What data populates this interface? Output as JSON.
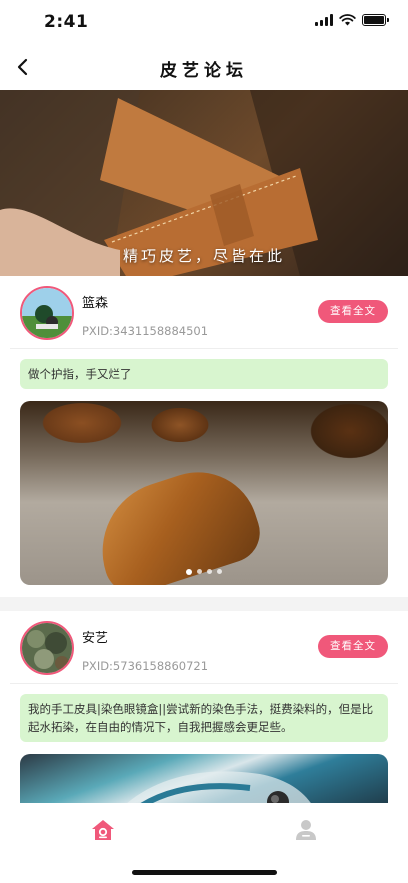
{
  "status_bar": {
    "time": "2:41"
  },
  "header": {
    "title": "皮艺论坛",
    "back_icon": "chevron-left-icon"
  },
  "banner": {
    "caption": "精巧皮艺，尽皆在此"
  },
  "posts": [
    {
      "author": "篮森",
      "pxid": "PXID:3431158884501",
      "read_more_label": "查看全文",
      "text": "做个护指，手又烂了",
      "image_dots": 4,
      "active_dot": 1
    },
    {
      "author": "安艺",
      "pxid": "PXID:5736158860721",
      "read_more_label": "查看全文",
      "text": "我的手工皮具|染色眼镜盒||尝试新的染色手法，挺费染料的，但是比起水拓染，在自由的情况下，自我把握感会更足些。"
    }
  ],
  "tab_bar": {
    "tabs": [
      {
        "icon": "home-icon",
        "active": true
      },
      {
        "icon": "person-icon",
        "active": false
      }
    ]
  },
  "colors": {
    "accent": "#f0587a",
    "post_text_bg": "#d8f5cf",
    "inactive_tab": "#c8c8c8"
  }
}
